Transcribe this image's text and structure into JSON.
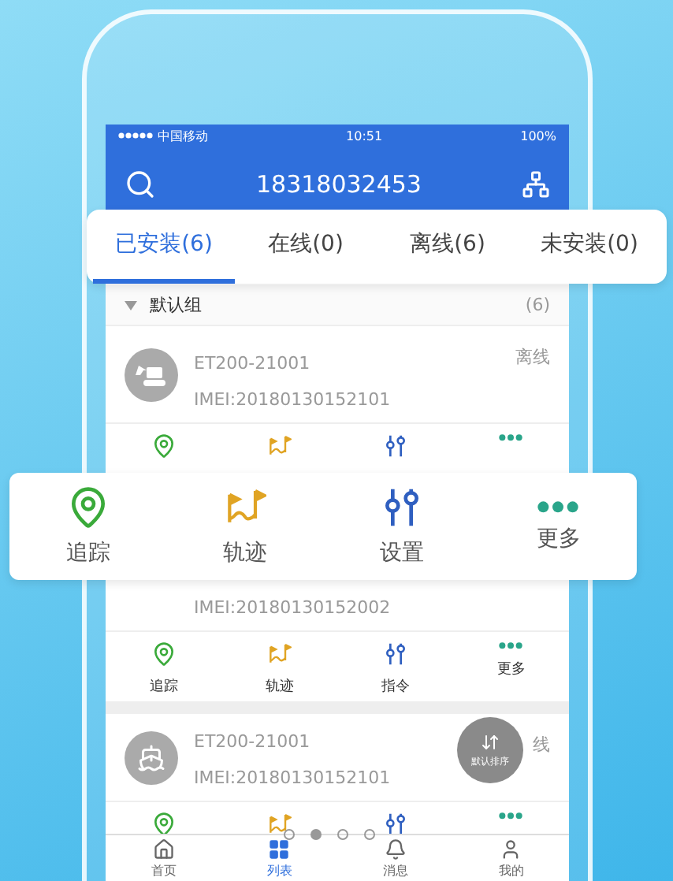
{
  "status_bar": {
    "carrier": "中国移动",
    "time": "10:51",
    "battery": "100%"
  },
  "header": {
    "title": "18318032453"
  },
  "tabs": [
    {
      "label": "已安装(6)",
      "selected": true
    },
    {
      "label": "在线(0)",
      "selected": false
    },
    {
      "label": "离线(6)",
      "selected": false
    },
    {
      "label": "未安装(0)",
      "selected": false
    }
  ],
  "group": {
    "name": "默认组",
    "count": "(6)",
    "expanded": true
  },
  "devices": [
    {
      "kind": "excavator",
      "name": "ET200-21001",
      "imei": "IMEI:20180130152101",
      "status": "离线",
      "actions": [
        {
          "kind": "track"
        },
        {
          "kind": "route"
        },
        {
          "kind": "command"
        },
        {
          "kind": "more"
        }
      ]
    },
    {
      "kind": "hidden",
      "imei": "IMEI:20180130152002",
      "actions": [
        {
          "kind": "track",
          "label": "追踪"
        },
        {
          "kind": "route",
          "label": "轨迹"
        },
        {
          "kind": "command",
          "label": "指令"
        },
        {
          "kind": "more",
          "label": "更多"
        }
      ]
    },
    {
      "kind": "ship",
      "name": "ET200-21001",
      "imei": "IMEI:20180130152101",
      "status": "线",
      "actions": [
        {
          "kind": "track"
        },
        {
          "kind": "route"
        },
        {
          "kind": "command"
        },
        {
          "kind": "more"
        }
      ]
    }
  ],
  "action_callout": [
    {
      "kind": "track",
      "label": "追踪"
    },
    {
      "kind": "route",
      "label": "轨迹"
    },
    {
      "kind": "command",
      "label": "设置"
    },
    {
      "kind": "more",
      "label": "更多"
    }
  ],
  "sort_button": {
    "label": "默认排序"
  },
  "carousel_dots": [
    {
      "selected": false
    },
    {
      "selected": true
    },
    {
      "selected": false
    },
    {
      "selected": false
    }
  ],
  "tab_bar": [
    {
      "kind": "home",
      "label": "首页",
      "selected": false
    },
    {
      "kind": "list",
      "label": "列表",
      "selected": true
    },
    {
      "kind": "bell",
      "label": "消息",
      "selected": false
    },
    {
      "kind": "user",
      "label": "我的",
      "selected": false
    }
  ]
}
